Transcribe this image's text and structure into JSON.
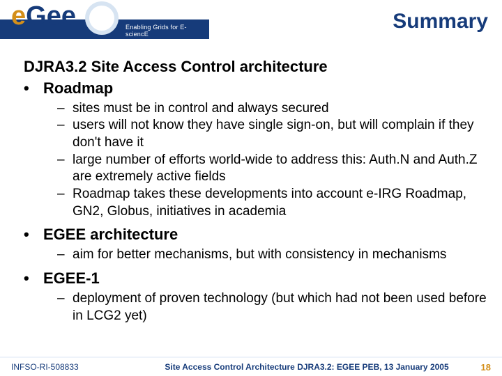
{
  "header": {
    "logo_text": "eGee",
    "tagline": "Enabling Grids for E-sciencE",
    "title": "Summary"
  },
  "heading": "DJRA3.2 Site Access Control architecture",
  "bullets": [
    {
      "label": "Roadmap",
      "subs": [
        "sites must be in control and always secured",
        "users will not know they have single sign-on, but will complain if they don't have it",
        "large number of efforts world-wide to address this: Auth.N and Auth.Z are extremely active fields",
        "Roadmap takes these developments into account e-IRG Roadmap, GN2, Globus, initiatives in academia"
      ]
    },
    {
      "label": "EGEE architecture",
      "subs": [
        "aim for better mechanisms, but with consistency in mechanisms"
      ]
    },
    {
      "label": "EGEE-1",
      "subs": [
        "deployment of proven technology (but which had not been used before in LCG2 yet)"
      ]
    }
  ],
  "footer": {
    "left": "INFSO-RI-508833",
    "center": "Site Access Control Architecture DJRA3.2: EGEE PEB, 13 January 2005",
    "page": "18"
  }
}
